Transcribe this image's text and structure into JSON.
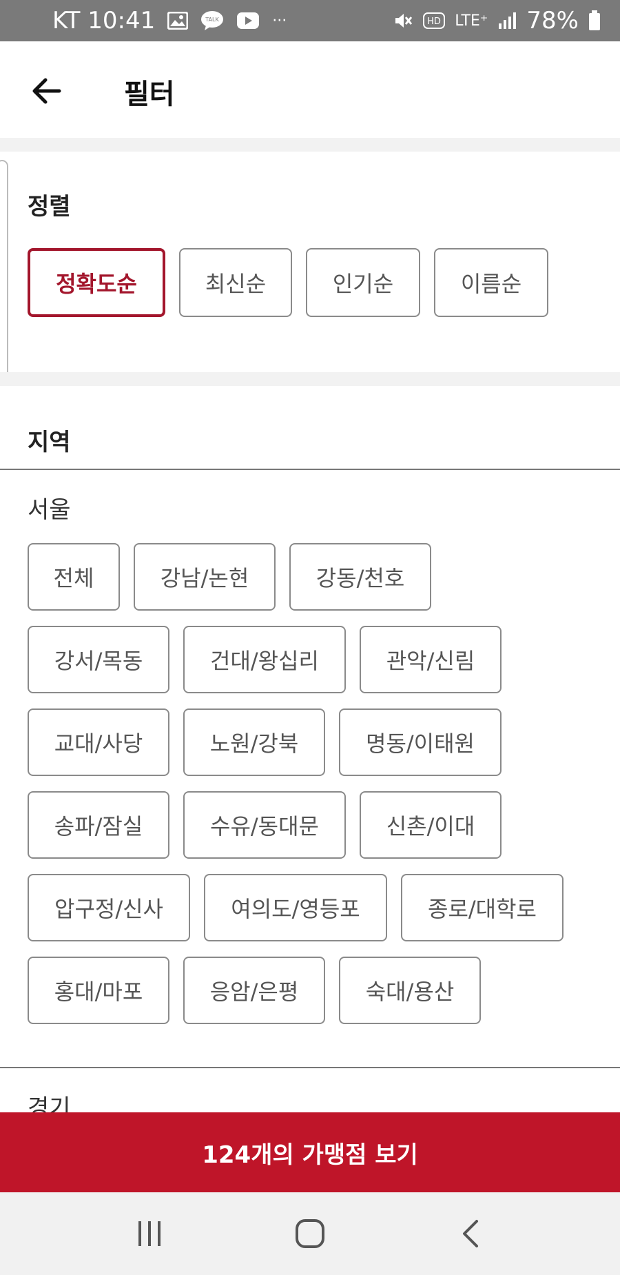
{
  "status_bar": {
    "carrier_time": "KT 10:41",
    "overflow": "···",
    "network": "LTE⁺",
    "battery": "78%"
  },
  "app_bar": {
    "title": "필터"
  },
  "sort": {
    "title": "정렬",
    "options": [
      "정확도순",
      "최신순",
      "인기순",
      "이름순"
    ],
    "selected": "정확도순"
  },
  "region": {
    "title": "지역",
    "seoul_label": "서울",
    "seoul_rows": [
      [
        "전체",
        "강남/논현",
        "강동/천호"
      ],
      [
        "강서/목동",
        "건대/왕십리",
        "관악/신림"
      ],
      [
        "교대/사당",
        "노원/강북",
        "명동/이태원"
      ],
      [
        "송파/잠실",
        "수유/동대문",
        "신촌/이대"
      ],
      [
        "압구정/신사",
        "여의도/영등포",
        "종로/대학로"
      ],
      [
        "홍대/마포",
        "응암/은평",
        "숙대/용산"
      ]
    ],
    "gyeonggi_label": "경기"
  },
  "cta": {
    "label": "124개의 가맹점 보기"
  },
  "colors": {
    "accent": "#bf1529",
    "selected_border": "#a3162c"
  }
}
